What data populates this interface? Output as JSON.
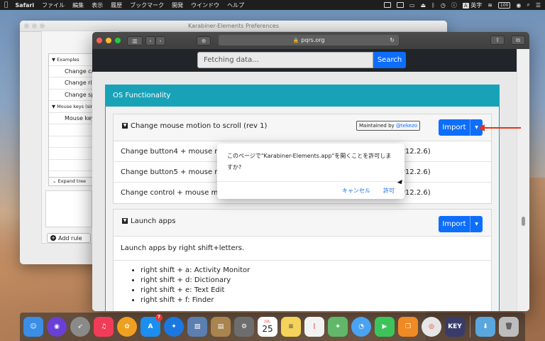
{
  "menubar": {
    "app": "Safari",
    "items": [
      "ファイル",
      "編集",
      "表示",
      "履歴",
      "ブックマーク",
      "開発",
      "ウインドウ",
      "ヘルプ"
    ],
    "input_mode": "A",
    "input_mode_label": "英字",
    "battery": "100"
  },
  "karabiner": {
    "title": "Karabiner-Elements Preferences",
    "tree": [
      {
        "label": "Examples",
        "type": "group"
      },
      {
        "label": "Change caps",
        "type": "leaf"
      },
      {
        "label": "Change right",
        "type": "leaf"
      },
      {
        "label": "Change spa",
        "type": "leaf"
      },
      {
        "label": "Mouse keys (sim",
        "type": "group"
      },
      {
        "label": "Mouse keys",
        "type": "leaf"
      }
    ],
    "expand_tree": "Expand tree",
    "add_rule": "Add rule"
  },
  "safari": {
    "url": "pqrs.org",
    "search_placeholder": "Fetching data...",
    "search_button": "Search"
  },
  "page": {
    "section_title": "OS Functionality",
    "card1": {
      "title": "Change mouse motion to scroll (rev 1)",
      "maintained_by": "Maintained by ",
      "maintainer": "@tekezo",
      "import": "Import",
      "rows": [
        {
          "label": "Change button4 + mouse motio",
          "version": "v12.2.6)"
        },
        {
          "label": "Change button5 + mouse motio",
          "version": "v12.2.6)"
        },
        {
          "label": "Change control + mouse motio",
          "version": "v12.2.6)"
        }
      ]
    },
    "card2": {
      "title": "Launch apps",
      "import": "Import",
      "description": "Launch apps by right shift+letters.",
      "items": [
        "right shift + a: Activity Monitor",
        "right shift + d: Dictionary",
        "right shift + e: Text Edit",
        "right shift + f: Finder"
      ]
    }
  },
  "dialog": {
    "message": "このページで\"Karabiner-Elements.app\"を開くことを許可しますか?",
    "cancel": "キャンセル",
    "allow": "許可"
  },
  "dock": {
    "appstore_badge": "7",
    "calendar_month": "JUL",
    "calendar_day": "25",
    "keynote_label": "KEY",
    "icons": [
      {
        "name": "finder-icon",
        "color": "#3a8ee6"
      },
      {
        "name": "siri-icon",
        "color": "#6a3fd6"
      },
      {
        "name": "launchpad-icon",
        "color": "#8a8a8a"
      },
      {
        "name": "music-icon",
        "color": "#f23c57"
      },
      {
        "name": "photos-icon",
        "color": "#f0a020"
      },
      {
        "name": "app-store-icon",
        "color": "#1c8ef0"
      },
      {
        "name": "safari-icon",
        "color": "#1a78e0"
      },
      {
        "name": "preview-icon",
        "color": "#5a7fb0"
      },
      {
        "name": "notes-brown-icon",
        "color": "#a9844e"
      },
      {
        "name": "system-preferences-icon",
        "color": "#6d6d6d"
      },
      {
        "name": "calendar-icon",
        "color": "#ffffff"
      },
      {
        "name": "notes-icon",
        "color": "#f5d35a"
      },
      {
        "name": "reminders-icon",
        "color": "#f2f2f2"
      },
      {
        "name": "maps-icon",
        "color": "#61b86a"
      },
      {
        "name": "messages-bubble-icon",
        "color": "#4aa3f0"
      },
      {
        "name": "facetime-icon",
        "color": "#3cc45a"
      },
      {
        "name": "books-icon",
        "color": "#f08a24"
      },
      {
        "name": "chrome-icon",
        "color": "#e6e6e6"
      },
      {
        "name": "keynote-icon",
        "color": "#3b3b6b"
      },
      {
        "name": "downloads-folder-icon",
        "color": "#5aa7de"
      },
      {
        "name": "trash-icon",
        "color": "#bdbdbd"
      }
    ]
  }
}
